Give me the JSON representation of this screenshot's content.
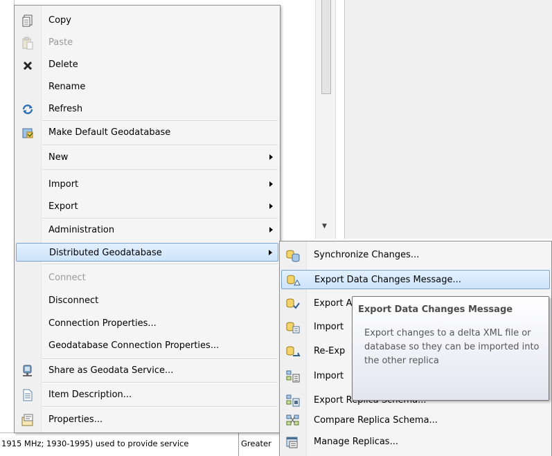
{
  "context_menu": {
    "items": [
      {
        "label": "Copy",
        "icon": "copy-icon",
        "disabled": false,
        "submenu": false
      },
      {
        "label": "Paste",
        "icon": "paste-icon",
        "disabled": true,
        "submenu": false
      },
      {
        "label": "Delete",
        "icon": "delete-icon",
        "disabled": false,
        "submenu": false
      },
      {
        "label": "Rename",
        "icon": "",
        "disabled": false,
        "submenu": false
      },
      {
        "label": "Refresh",
        "icon": "refresh-icon",
        "disabled": false,
        "submenu": false
      },
      {
        "label": "Make Default Geodatabase",
        "icon": "default-geodatabase-icon",
        "disabled": false,
        "submenu": false
      },
      {
        "label": "New",
        "icon": "",
        "disabled": false,
        "submenu": true
      },
      {
        "label": "Import",
        "icon": "",
        "disabled": false,
        "submenu": true
      },
      {
        "label": "Export",
        "icon": "",
        "disabled": false,
        "submenu": true
      },
      {
        "label": "Administration",
        "icon": "",
        "disabled": false,
        "submenu": true
      },
      {
        "label": "Distributed Geodatabase",
        "icon": "",
        "disabled": false,
        "submenu": true,
        "highlighted": true
      },
      {
        "label": "Connect",
        "icon": "",
        "disabled": true,
        "submenu": false
      },
      {
        "label": "Disconnect",
        "icon": "",
        "disabled": false,
        "submenu": false
      },
      {
        "label": "Connection Properties...",
        "icon": "",
        "disabled": false,
        "submenu": false
      },
      {
        "label": "Geodatabase Connection Properties...",
        "icon": "",
        "disabled": false,
        "submenu": false
      },
      {
        "label": "Share as Geodata Service...",
        "icon": "geodata-service-icon",
        "disabled": false,
        "submenu": false
      },
      {
        "label": "Item Description...",
        "icon": "item-description-icon",
        "disabled": false,
        "submenu": false
      },
      {
        "label": "Properties...",
        "icon": "properties-icon",
        "disabled": false,
        "submenu": false
      }
    ]
  },
  "submenu": {
    "items": [
      {
        "label": "Synchronize Changes...",
        "icon": "synchronize-changes-icon"
      },
      {
        "label": "Export Data Changes Message...",
        "icon": "export-data-changes-icon",
        "highlighted": true
      },
      {
        "label": "Export Acknowledgment Message...",
        "visible_label": "Export A",
        "icon": "export-acknowledgment-icon"
      },
      {
        "label": "Import Message...",
        "visible_label": "Import",
        "icon": "import-message-icon"
      },
      {
        "label": "Re-Export Unacknowledged Messages...",
        "visible_label": "Re-Exp",
        "icon": "re-export-icon"
      },
      {
        "label": "Import Replica Schema Changes...",
        "visible_label": "Import",
        "icon": "import-schema-icon"
      },
      {
        "label": "Export Replica Schema...",
        "icon": "export-replica-schema-icon"
      },
      {
        "label": "Compare Replica Schema...",
        "icon": "compare-replica-schema-icon"
      },
      {
        "label": "Manage Replicas...",
        "icon": "manage-replicas-icon"
      }
    ]
  },
  "tooltip": {
    "title": "Export Data Changes Message",
    "body": "Export changes to a delta XML file or database so they can be imported into the other replica"
  },
  "background": {
    "bottom_row": {
      "cell1": "1915 MHz; 1930-1995) used to provide service",
      "cell2": "Greater"
    }
  },
  "colors": {
    "highlight_border": "#7da2ce",
    "highlight_fill": "#cde4fb",
    "disabled_text": "#9a9a9a"
  }
}
